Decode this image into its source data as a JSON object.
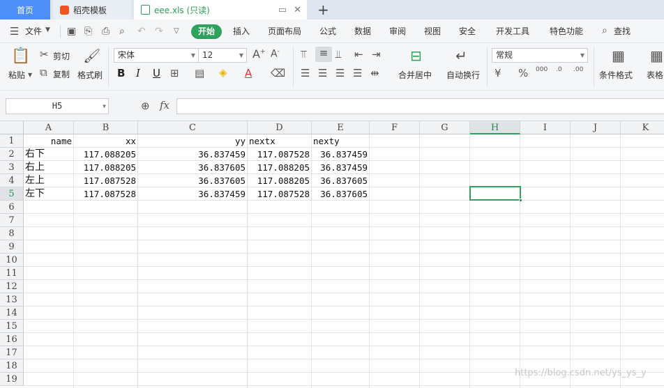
{
  "tabs": {
    "home": "首页",
    "docer": "稻壳模板",
    "file": "eee.xls (只读)",
    "new_tab": "+"
  },
  "menu": {
    "file": "文件",
    "items": [
      "开始",
      "插入",
      "页面布局",
      "公式",
      "数据",
      "审阅",
      "视图",
      "安全",
      "开发工具",
      "特色功能"
    ],
    "search": "查找"
  },
  "ribbon": {
    "paste": "粘贴",
    "cut": "剪切",
    "copy": "复制",
    "format_painter": "格式刷",
    "font_name": "宋体",
    "font_size": "12",
    "merge_center": "合并居中",
    "wrap_text": "自动换行",
    "number_format": "常规",
    "conditional_format": "条件格式",
    "table_style": "表格",
    "bold": "B",
    "italic": "I",
    "underline": "U",
    "font_grow": "A",
    "font_shrink": "A"
  },
  "formula_bar": {
    "name_box": "H5",
    "fx": "fx",
    "formula": ""
  },
  "sheet": {
    "columns": [
      "A",
      "B",
      "C",
      "D",
      "E",
      "F",
      "G",
      "H",
      "I",
      "J",
      "K"
    ],
    "selected_column": "H",
    "selected_row": "5",
    "rows": [
      "1",
      "2",
      "3",
      "4",
      "5",
      "6",
      "7",
      "8",
      "9",
      "10",
      "11",
      "12",
      "13",
      "14",
      "15",
      "16",
      "17",
      "18",
      "19"
    ],
    "cells": [
      [
        "name",
        "xx",
        "yy",
        "nextx",
        "nexty"
      ],
      [
        "右下",
        "117.088205",
        "36.837459",
        "117.087528",
        "36.837459"
      ],
      [
        "右上",
        "117.088205",
        "36.837605",
        "117.088205",
        "36.837459"
      ],
      [
        "左上",
        "117.087528",
        "36.837605",
        "117.088205",
        "36.837605"
      ],
      [
        "左下",
        "117.087528",
        "36.837459",
        "117.087528",
        "36.837605"
      ]
    ]
  },
  "watermark": "https://blog.csdn.net/ys_ys_y",
  "colors": {
    "accent": "#2ea15d",
    "home_tab": "#4e8ef7"
  }
}
